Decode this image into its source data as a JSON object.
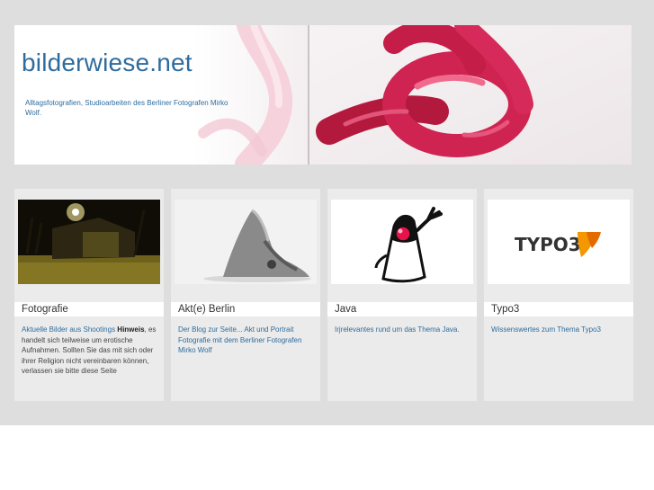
{
  "header": {
    "title": "bilderwiese.net",
    "description": "Alltagsfotografien, Studioarbeiten des Berliner Fotografen Mirko Wolf."
  },
  "cards": [
    {
      "title": "Fotografie",
      "text_link": "Aktuelle Bilder aus Shootings",
      "text_bold": "Hinweis",
      "text_rest": ", es handelt sich teilweise um erotische Aufnahmen. Sollten Sie das mit sich oder ihrer Religion nicht vereinbaren können, verlassen sie bitte diese Seite"
    },
    {
      "title": "Akt(e) Berlin",
      "text": "Der Blog zur Seite... Akt und Portrait Fotografie mit dem Berliner Fotografen Mirko Wolf"
    },
    {
      "title": "Java",
      "text": "Irjrelevantes rund um das Thema Java."
    },
    {
      "title": "Typo3",
      "text": "Wissenswertes zum Thema Typo3",
      "logo_text": "TYPO3"
    }
  ],
  "colors": {
    "link": "#2e6c9e",
    "page_bg": "#dedede",
    "card_bg": "#ebebeb",
    "typo3_orange": "#f49700"
  }
}
